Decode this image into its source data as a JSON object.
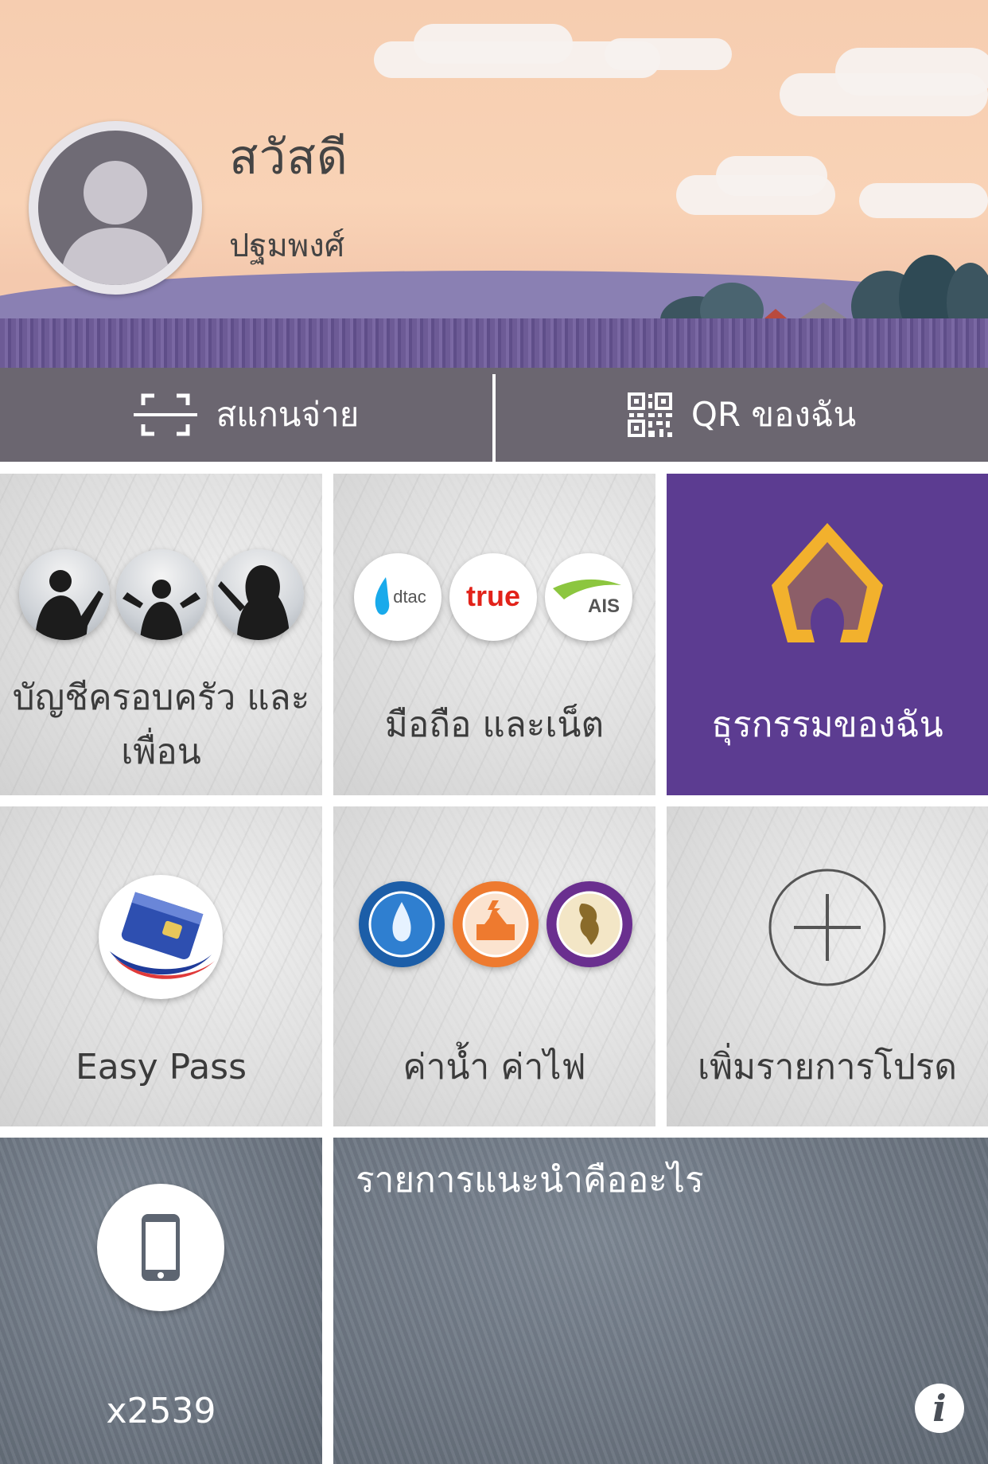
{
  "profile": {
    "greeting": "สวัสดี",
    "name": "ปฐมพงศ์"
  },
  "actions": {
    "scan": {
      "label": "สแกนจ่าย",
      "icon": "scan-frame-icon"
    },
    "qr": {
      "label": "QR ของฉัน",
      "icon": "qr-code-icon"
    }
  },
  "tiles": {
    "family": {
      "label_line1": "บัญชีครอบครัว และ",
      "label_line2": "เพื่อน"
    },
    "mobile": {
      "label": "มือถือ และเน็ต",
      "operators": [
        "dtac",
        "true",
        "AIS"
      ]
    },
    "transactions": {
      "label": "ธุรกรรมของฉัน"
    },
    "easypass": {
      "label": "Easy Pass"
    },
    "utilities": {
      "label": "ค่าน้ำ ค่าไฟ"
    },
    "add_favorite": {
      "label": "เพิ่มรายการโปรด"
    },
    "phone": {
      "label": "x2539"
    },
    "recommend": {
      "label": "รายการแนะนำคืออะไร",
      "info": "i"
    }
  },
  "colors": {
    "header_sky": "#f9d3b6",
    "action_bar": "#6b6670",
    "brand_purple": "#5c3c91",
    "brand_gold": "#f2b12d",
    "slate": "#6c7581"
  }
}
